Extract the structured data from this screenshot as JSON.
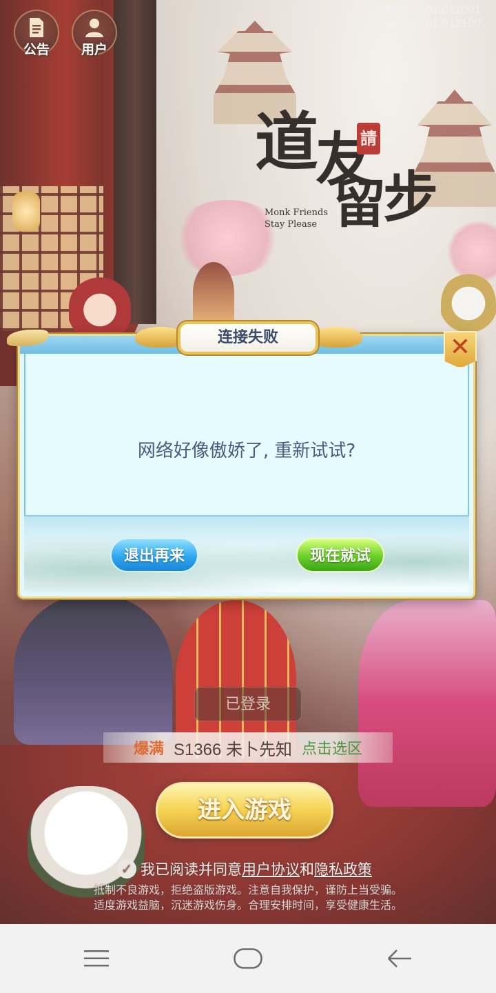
{
  "top_bar": {
    "notice_label": "公告",
    "user_label": "用户",
    "app_version": "APP: 2.01.012001",
    "res_version": "RES: 2.01.012100"
  },
  "logo": {
    "chars": [
      "道",
      "友",
      "留",
      "步"
    ],
    "seal": "請",
    "english_line1": "Monk Friends",
    "english_line2": "Stay Please"
  },
  "dialog": {
    "title": "连接失败",
    "message": "网络好像傲娇了, 重新试试?",
    "quit_label": "退出再来",
    "retry_label": "现在就试",
    "close_icon": "close-icon"
  },
  "game_ui": {
    "logged_in_label": "已登录",
    "server_status": "爆满",
    "server_name": "S1366 未卜先知",
    "server_select": "点击选区",
    "enter_game_label": "进入游戏",
    "agree_prefix": "我已阅读并同意",
    "agree_link1": "用户协议",
    "agree_and": "和",
    "agree_link2": "隐私政策",
    "notice_line1": "抵制不良游戏，拒绝盗版游戏。注意自我保护，谨防上当受骗。",
    "notice_line2": "适度游戏益脑，沉迷游戏伤身。合理安排时间，享受健康生活。"
  },
  "navbar": {
    "menu_icon": "menu-icon",
    "home_icon": "home-icon",
    "back_icon": "back-icon"
  },
  "colors": {
    "dialog_bg": "#e3f8fd",
    "retry_green": "#6ccf2a",
    "quit_blue": "#2ea7ee",
    "gold": "#f3cd3a"
  }
}
